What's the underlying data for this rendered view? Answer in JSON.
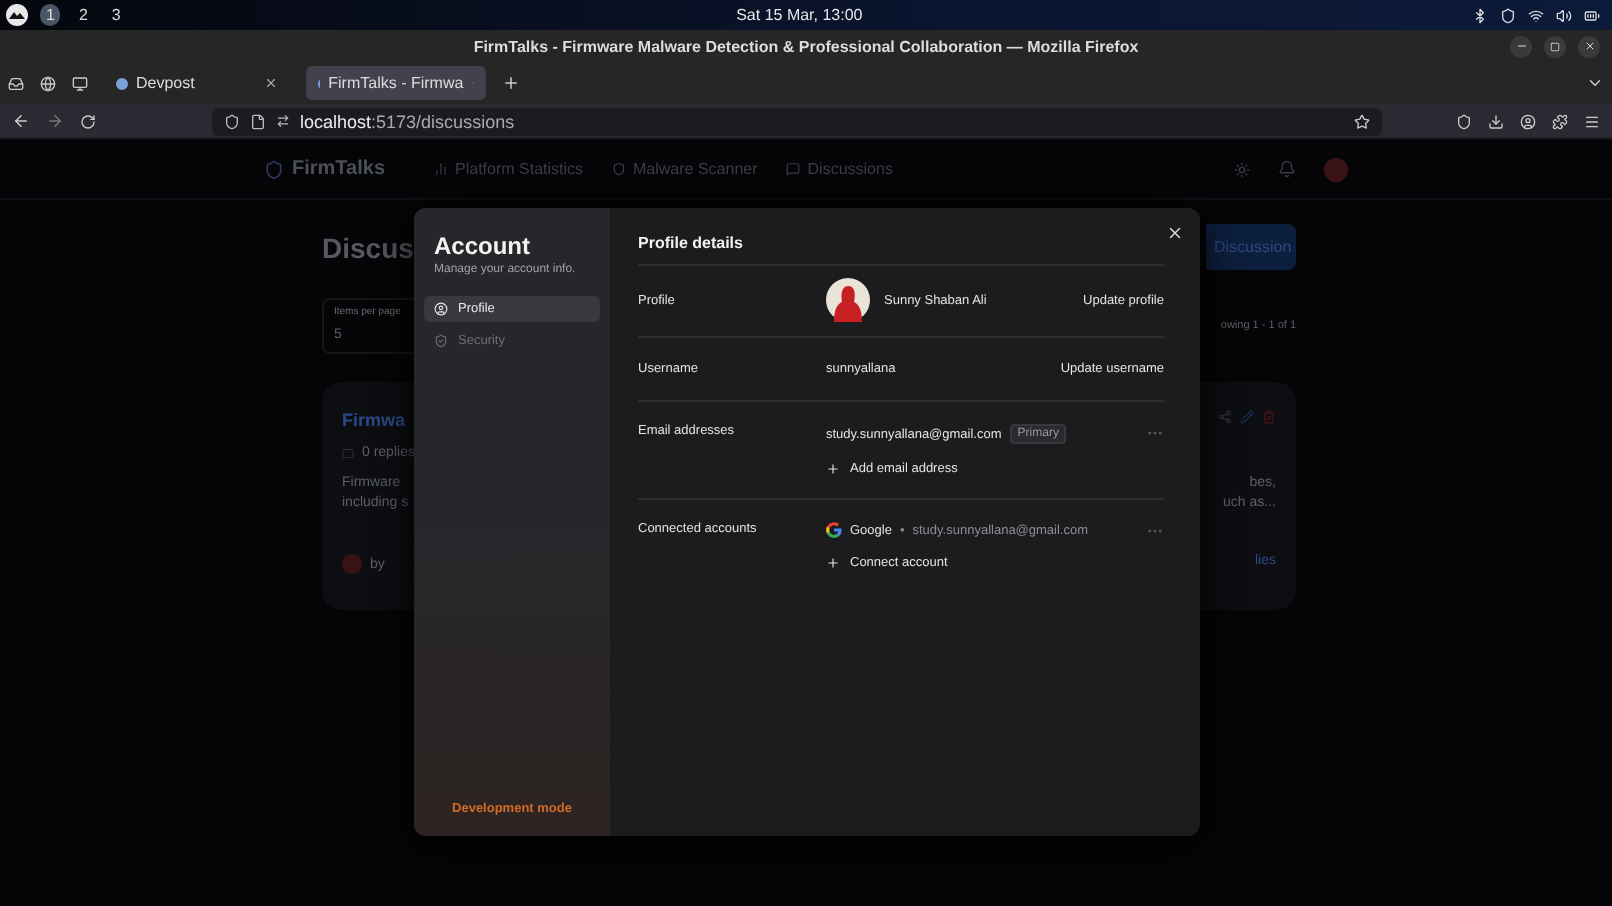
{
  "desktop_bar": {
    "workspaces": [
      {
        "label": "1",
        "selected": true
      },
      {
        "label": "2",
        "selected": false
      },
      {
        "label": "3",
        "selected": false
      }
    ],
    "clock": "Sat 15 Mar, 13:00"
  },
  "window": {
    "title": "FirmTalks - Firmware Malware Detection & Professional Collaboration — Mozilla Firefox"
  },
  "tabs": [
    {
      "label": "Devpost",
      "selected": false
    },
    {
      "label": "FirmTalks - Firmwa",
      "selected": true
    }
  ],
  "address_bar": {
    "host": "localhost",
    "path": ":5173/discussions"
  },
  "app_nav": {
    "brand": "FirmTalks",
    "links": [
      "Platform Statistics",
      "Malware Scanner",
      "Discussions"
    ]
  },
  "page": {
    "title": "Discus",
    "new_button": "Discussion",
    "page_size_label": "Items per page",
    "page_size": "5",
    "showing": "owing 1 - 1 of 1",
    "card": {
      "title": "Firmwa",
      "replies": "0 replies",
      "excerpt_left": [
        "Firmware",
        "including s"
      ],
      "excerpt_right": [
        "bes,",
        "uch as..."
      ],
      "author_prefix": "by",
      "link": "lies"
    }
  },
  "modal": {
    "title": "Account",
    "subtitle": "Manage your account info.",
    "footer": "Development mode",
    "heading": "Profile details",
    "nav": [
      {
        "label": "Profile",
        "selected": true
      },
      {
        "label": "Security",
        "selected": false
      }
    ],
    "rows": [
      {
        "kind": "profile",
        "label": "Profile",
        "value": "Sunny Shaban Ali",
        "action": "Update profile"
      },
      {
        "kind": "text",
        "label": "Username",
        "value": "sunnyallana",
        "action": "Update username"
      },
      {
        "kind": "emails",
        "label": "Email addresses",
        "items": [
          {
            "email": "study.sunnyallana@gmail.com",
            "badge": "Primary"
          }
        ],
        "add": "Add email address"
      },
      {
        "kind": "accounts",
        "label": "Connected accounts",
        "items": [
          {
            "provider": "Google",
            "separator": "•",
            "email": "study.sunnyallana@gmail.com"
          }
        ],
        "add": "Connect account"
      }
    ]
  }
}
